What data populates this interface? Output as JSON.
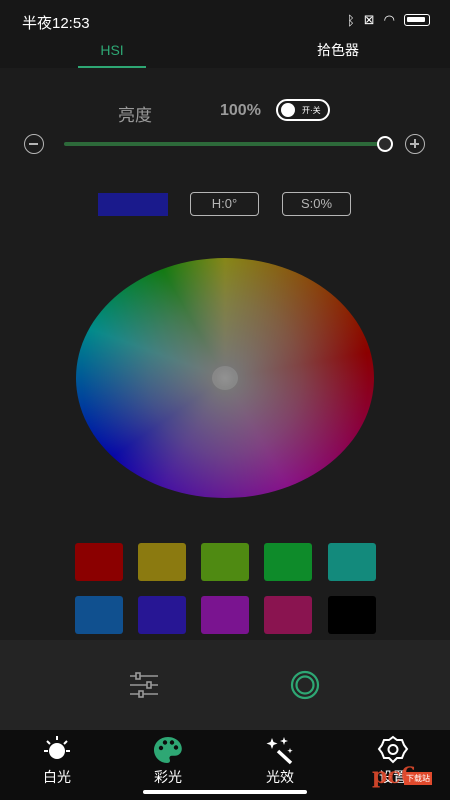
{
  "status": {
    "time": "半夜12:53",
    "icons": [
      "bluetooth-icon",
      "notification-x-icon",
      "wifi-icon",
      "battery-icon"
    ]
  },
  "tabs": [
    {
      "label": "HSI",
      "active": true
    },
    {
      "label": "拾色器",
      "active": false
    }
  ],
  "brightness": {
    "label": "亮度",
    "value": "100%",
    "toggle_label": "开·关",
    "toggle_on": true,
    "level": 1.0
  },
  "current_color": {
    "hex": "#1a1a8c",
    "hue_label": "H:0°",
    "saturation_label": "S:0%"
  },
  "presets": [
    {
      "name": "dark-red",
      "hex": "#8b0000"
    },
    {
      "name": "olive",
      "hex": "#8b7a10"
    },
    {
      "name": "olive-green",
      "hex": "#4f8a12"
    },
    {
      "name": "green",
      "hex": "#0e8b2a"
    },
    {
      "name": "teal",
      "hex": "#138a7c"
    },
    {
      "name": "steel-blue",
      "hex": "#10508f"
    },
    {
      "name": "indigo",
      "hex": "#271694"
    },
    {
      "name": "purple",
      "hex": "#7a1490"
    },
    {
      "name": "crimson",
      "hex": "#8a1450"
    },
    {
      "name": "black",
      "hex": "#000000"
    }
  ],
  "nav": [
    {
      "label": "白光",
      "icon": "sun-icon"
    },
    {
      "label": "彩光",
      "icon": "palette-icon",
      "active": true
    },
    {
      "label": "光效",
      "icon": "magic-wand-icon"
    },
    {
      "label": "设置",
      "icon": "settings-icon"
    }
  ],
  "watermark": {
    "text": "pc6",
    "sub": "下载站"
  },
  "colors": {
    "accent": "#2ea774",
    "background": "#1c1c1c",
    "navbar": "#0d0d0d"
  }
}
